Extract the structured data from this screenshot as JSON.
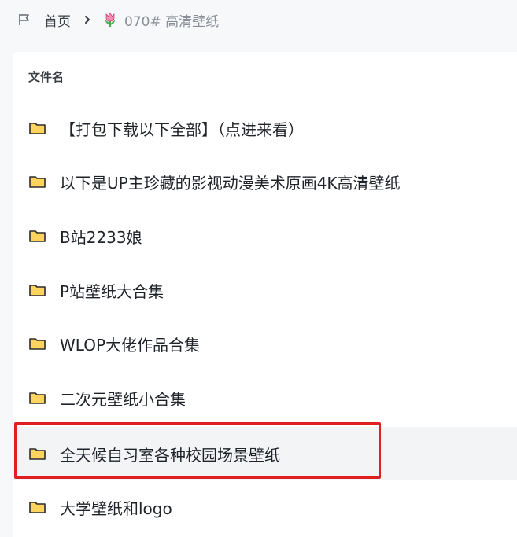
{
  "breadcrumb": {
    "home_label": "首页",
    "current_label": "070# 高清壁纸"
  },
  "list": {
    "header": "文件名",
    "items": [
      {
        "name": "【打包下载以下全部】（点进来看）",
        "icon": "folder-icon"
      },
      {
        "name": "以下是UP主珍藏的影视动漫美术原画4K高清壁纸",
        "icon": "folder-icon"
      },
      {
        "name": "B站2233娘",
        "icon": "folder-icon"
      },
      {
        "name": "P站壁纸大合集",
        "icon": "folder-icon"
      },
      {
        "name": "WLOP大佬作品合集",
        "icon": "folder-icon"
      },
      {
        "name": "二次元壁纸小合集",
        "icon": "folder-icon"
      },
      {
        "name": "全天候自习室各种校园场景壁纸",
        "icon": "folder-icon"
      },
      {
        "name": "大学壁纸和logo",
        "icon": "folder-icon"
      }
    ]
  },
  "colors": {
    "highlight_border": "#e02020",
    "folder_fill": "#ffd45e",
    "folder_stroke": "#2b2b2b"
  }
}
